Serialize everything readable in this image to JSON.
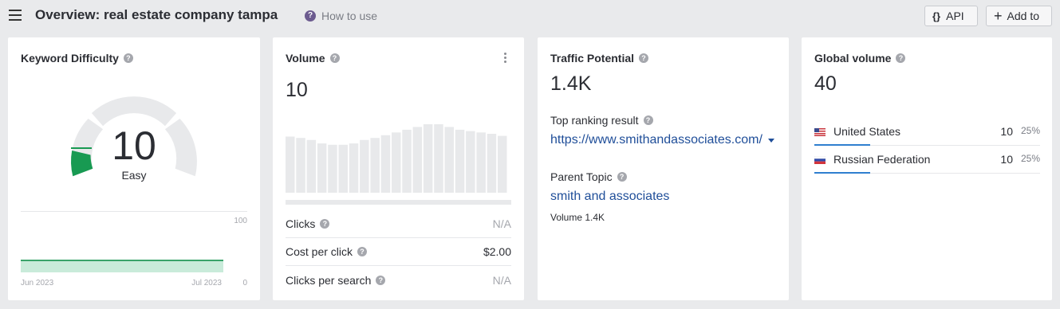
{
  "header": {
    "title": "Overview: real estate company tampa",
    "help_label": "How to use",
    "api_label": "API",
    "add_label": "Add to"
  },
  "kd": {
    "title": "Keyword Difficulty",
    "value": "10",
    "label": "Easy",
    "gauge_fraction": 0.1,
    "axis_top": "100",
    "axis_bottom": "0",
    "date_start": "Jun 2023",
    "date_end": "Jul 2023",
    "accent": "#189a52"
  },
  "volume": {
    "title": "Volume",
    "value": "10",
    "bar_levels": [
      0.82,
      0.8,
      0.77,
      0.72,
      0.7,
      0.7,
      0.72,
      0.77,
      0.8,
      0.84,
      0.88,
      0.92,
      0.96,
      1.0,
      1.0,
      0.96,
      0.92,
      0.9,
      0.88,
      0.86,
      0.83
    ],
    "metrics": [
      {
        "label": "Clicks",
        "value": "N/A"
      },
      {
        "label": "Cost per click",
        "value": "$2.00"
      },
      {
        "label": "Clicks per search",
        "value": "N/A"
      }
    ]
  },
  "traffic": {
    "title": "Traffic Potential",
    "value": "1.4K",
    "top_result_label": "Top ranking result",
    "top_result_url": "https://www.smithandassociates.com/",
    "parent_topic_label": "Parent Topic",
    "parent_topic": "smith and associates",
    "parent_volume": "Volume 1.4K"
  },
  "global": {
    "title": "Global volume",
    "value": "40",
    "countries": [
      {
        "name": "United States",
        "volume": "10",
        "share": "25%",
        "flag": "us-flag-icon"
      },
      {
        "name": "Russian Federation",
        "volume": "10",
        "share": "25%",
        "flag": "ru-flag-icon"
      }
    ]
  }
}
